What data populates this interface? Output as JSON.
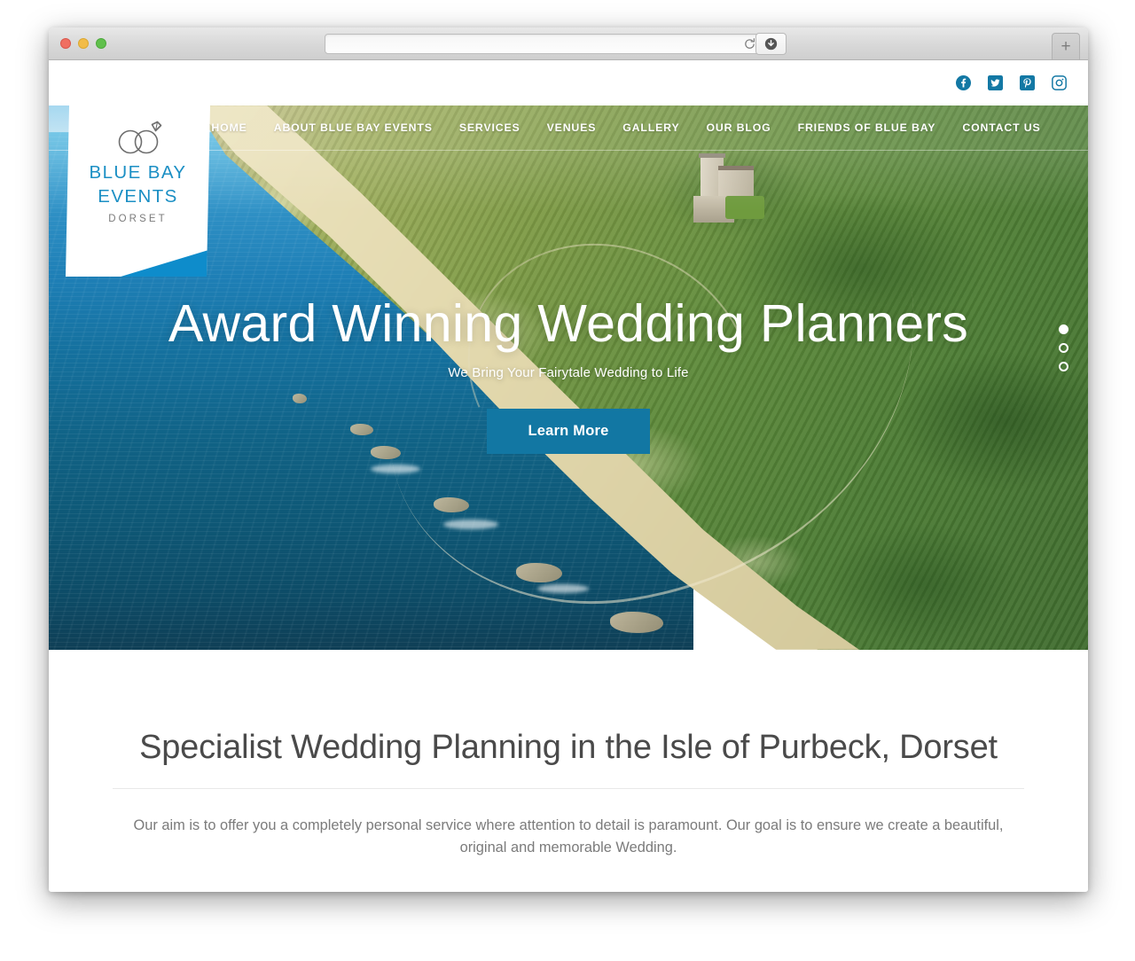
{
  "browser": {
    "url_value": "",
    "url_placeholder": "",
    "reload_label": "reload-icon",
    "download_label": "download-icon",
    "newtab_label": "+",
    "traffic_lights": [
      "close",
      "minimize",
      "maximize"
    ]
  },
  "colors": {
    "brand_blue": "#1378a4",
    "logo_blue": "#1b8fc4",
    "logo_swoosh": "#0e8ccb",
    "cta_blue": "#1277a3",
    "heading_gray": "#4a4a4a",
    "body_gray": "#7b7b7b"
  },
  "social": [
    {
      "name": "facebook",
      "glyph": "facebook-icon"
    },
    {
      "name": "twitter",
      "glyph": "twitter-icon"
    },
    {
      "name": "pinterest",
      "glyph": "pinterest-icon"
    },
    {
      "name": "instagram",
      "glyph": "instagram-icon"
    }
  ],
  "logo": {
    "line1": "BLUE BAY",
    "line2": "EVENTS",
    "line3": "DORSET",
    "mark": "wedding-rings-icon"
  },
  "nav": {
    "items": [
      {
        "label": "HOME"
      },
      {
        "label": "ABOUT BLUE BAY EVENTS"
      },
      {
        "label": "SERVICES"
      },
      {
        "label": "VENUES"
      },
      {
        "label": "GALLERY"
      },
      {
        "label": "OUR BLOG"
      },
      {
        "label": "FRIENDS OF BLUE BAY"
      },
      {
        "label": "CONTACT US"
      }
    ]
  },
  "hero": {
    "title": "Award Winning Wedding Planners",
    "subtitle": "We Bring Your Fairytale Wedding to Life",
    "cta_label": "Learn More",
    "slides": [
      {
        "active": true
      },
      {
        "active": false
      },
      {
        "active": false
      }
    ]
  },
  "main": {
    "heading": "Specialist Wedding Planning in the Isle of Purbeck, Dorset",
    "paragraph": "Our aim is to offer you a completely personal service where attention to detail is paramount. Our goal is to ensure we create a beautiful, original and memorable Wedding."
  }
}
